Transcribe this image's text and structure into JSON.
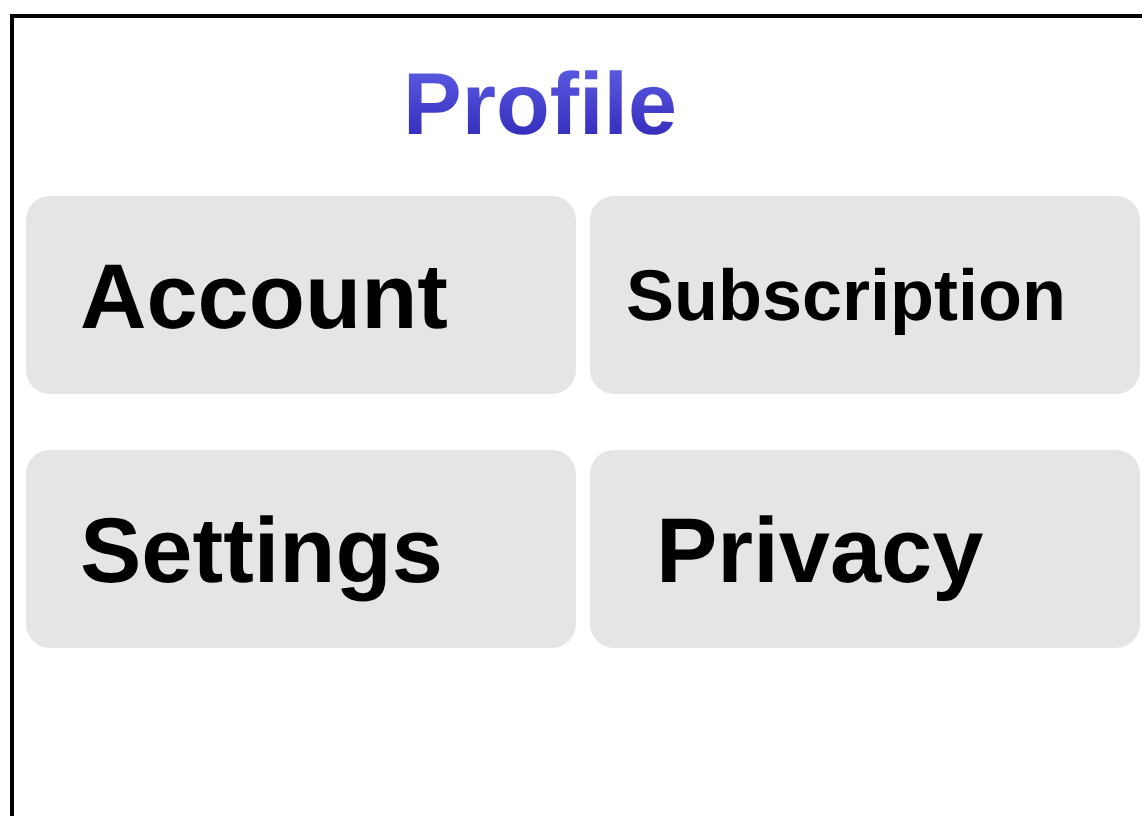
{
  "title": "Profile",
  "buttons": [
    "Account",
    "Subscription",
    "Settings",
    "Privacy"
  ]
}
